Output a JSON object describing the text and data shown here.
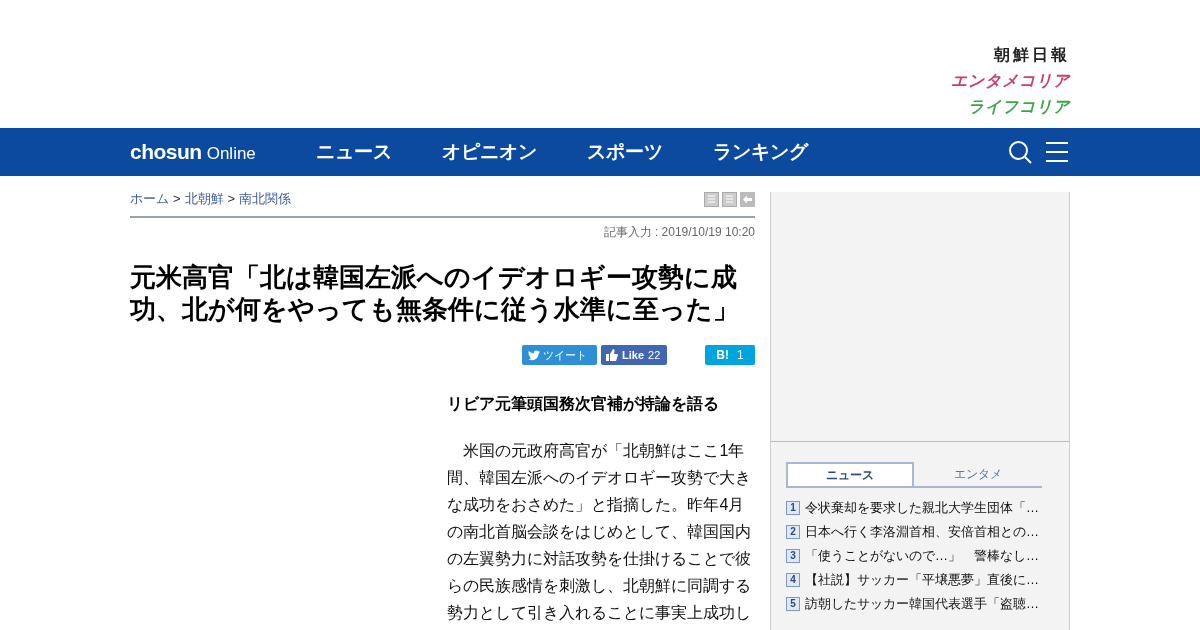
{
  "header": {
    "logos": [
      {
        "text": "朝鮮日報",
        "color": "#222222"
      },
      {
        "text": "エンタメコリア",
        "color": "#cc3b72"
      },
      {
        "text": "ライフコリア",
        "color": "#3aa84a"
      }
    ]
  },
  "nav": {
    "brand": "chosun",
    "brand_suffix": "Online",
    "items": [
      "ニュース",
      "オピニオン",
      "スポーツ",
      "ランキング"
    ]
  },
  "breadcrumb": [
    "ホーム",
    "北朝鮮",
    "南北関係"
  ],
  "breadcrumb_separator": ">",
  "article": {
    "date": "記事入力 : 2019/10/19 10:20",
    "title": "元米高官「北は韓国左派へのイデオロギー攻勢に成功、北が何をやっても無条件に従う水準に至った」",
    "share": {
      "tweet": "ツイート",
      "like": "Like",
      "like_count": "22",
      "hatena": "B!",
      "hatena_count": "1"
    },
    "subtitle": "リビア元筆頭国務次官補が持論を語る",
    "body_lines": [
      "　米国の元政府高官が「北朝鮮はここ1年",
      "間、韓国左派へのイデオロギー攻勢で大き",
      "な成功をおさめた」と指摘した。昨年4月",
      "の南北首脳会談をはじめとして、韓国国内",
      "の左翼勢力に対話攻勢を仕掛けることで彼",
      "らの民族感情を刺激し、北朝鮮に同調する",
      "勢力として引き入れることに事実上成功し"
    ]
  },
  "sidebar": {
    "tabs": [
      {
        "label": "ニュース",
        "selected": true
      },
      {
        "label": "エンタメ",
        "selected": false
      }
    ],
    "ranking": [
      {
        "rank": "1",
        "title": "令状棄却を要求した親北大学生団体「…"
      },
      {
        "rank": "2",
        "title": "日本へ行く李洛淵首相、安倍首相との…"
      },
      {
        "rank": "3",
        "title": "「使うことがないので…」　警棒なし…"
      },
      {
        "rank": "4",
        "title": "【社説】サッカー「平壌悪夢」直後に…"
      },
      {
        "rank": "5",
        "title": "訪朝したサッカー韓国代表選手「盗聴…"
      }
    ]
  }
}
